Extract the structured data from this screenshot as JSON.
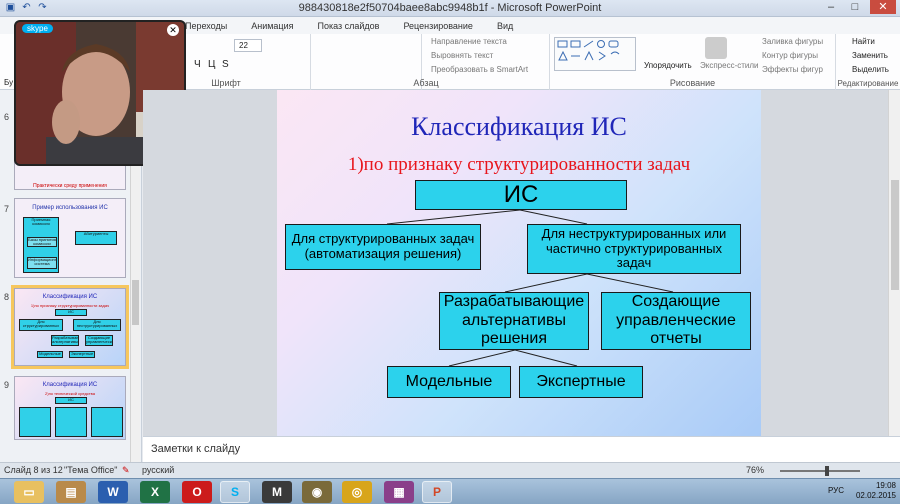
{
  "window": {
    "title": "988430818e2f50704baee8abc9948b1f  -  Microsoft PowerPoint",
    "controls": [
      "–",
      "□",
      "✕"
    ]
  },
  "qat_icons": [
    "save-icon",
    "undo-icon",
    "redo-icon"
  ],
  "ribbon_tabs": [
    "Переходы",
    "Анимация",
    "Показ слайдов",
    "Рецензирование",
    "Вид"
  ],
  "ribbon": {
    "font_size": "22",
    "font_group_label": "Шрифт",
    "font_buttons": [
      "Ч",
      "Ц",
      "S"
    ],
    "paragraph_group_label": "Абзац",
    "text_direction": "Направление текста",
    "align_text": "Выровнять текст",
    "convert_smartart": "Преобразовать в SmartArt",
    "arrange": "Упорядочить",
    "quick_styles": "Экспресс-стили",
    "drawing_group_label": "Рисование",
    "shape_fill": "Заливка фигуры",
    "shape_outline": "Контур фигуры",
    "shape_effects": "Эффекты фигур",
    "find": "Найти",
    "replace": "Заменить",
    "select": "Выделить",
    "editing_group_label": "Редактирование",
    "bu_label": "Бу"
  },
  "skype": {
    "logo": "skype"
  },
  "thumbnails": {
    "t6": {
      "number": "6",
      "caption": "Практически среду применения"
    },
    "t7": {
      "number": "7",
      "title": "Пример использования ИС",
      "boxes": [
        "Приемная комиссия",
        "Базы принятия комиссии",
        "Абитуриенты",
        "Информационная система"
      ]
    },
    "t8": {
      "number": "8",
      "title": "Классификация ИС",
      "subtitle": "1)по признаку структурированности задач",
      "boxes": [
        "ИС",
        "Для структурированных задач",
        "Для неструктурированных",
        "Разрабатывающие альтернативы решения",
        "Создающие управленческие отчеты",
        "Модельные",
        "Экспертные"
      ]
    },
    "t9": {
      "number": "9",
      "title": "Классификация ИС",
      "subtitle": "2)по технической средства",
      "boxes": [
        "ИС"
      ]
    }
  },
  "slide": {
    "title": "Классификация ИС",
    "subtitle": "1)по признаку структурированности задач",
    "nodes": {
      "root": "ИС",
      "structured": "Для структурированных задач (автоматизация решения)",
      "unstructured": "Для неструктурированных или частично структурированных задач",
      "alternatives": "Разрабатывающие альтернативы решения",
      "reports": "Создающие управленческие отчеты",
      "model": "Модельные",
      "expert": "Экспертные"
    }
  },
  "notes": {
    "placeholder": "Заметки к слайду"
  },
  "status": {
    "slide_info": "Слайд 8 из 12",
    "theme": "\"Тема Office\"",
    "language": "русский",
    "zoom": "76%"
  },
  "taskbar": {
    "apps": [
      "explorer-icon",
      "archive-icon",
      "word-icon",
      "excel-icon",
      "opera-icon",
      "skype-icon",
      "media-icon",
      "video-icon",
      "chrome-icon",
      "winrar-icon",
      "powerpoint-icon"
    ],
    "tray_lang": "РУС",
    "time": "19:08",
    "date": "02.02.2015"
  },
  "colors": {
    "node_fill": "#2cd2ec",
    "title_color": "#2026b8",
    "subtitle_color": "#e8151c",
    "selection_outline": "#f6c75d"
  }
}
